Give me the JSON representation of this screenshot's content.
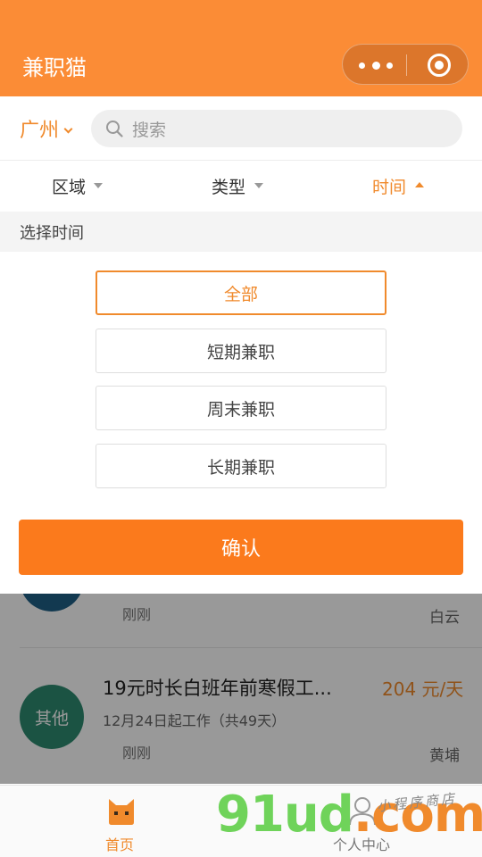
{
  "nav": {
    "title": "兼职猫"
  },
  "search": {
    "city": "广州",
    "placeholder": "搜索"
  },
  "filters": [
    {
      "label": "区域",
      "active": false
    },
    {
      "label": "类型",
      "active": false
    },
    {
      "label": "时间",
      "active": true
    }
  ],
  "dropdown": {
    "header": "选择时间",
    "options": [
      {
        "label": "全部",
        "selected": true
      },
      {
        "label": "短期兼职",
        "selected": false
      },
      {
        "label": "周末兼职",
        "selected": false
      },
      {
        "label": "长期兼职",
        "selected": false
      }
    ],
    "confirm_label": "确认"
  },
  "jobs": [
    {
      "time": "刚刚",
      "area": "白云",
      "avatar_color": "#1f5f86"
    },
    {
      "avatar_label": "其他",
      "avatar_color": "#2e8a70",
      "title": "19元时长白班年前寒假工...",
      "salary": "204 元/天",
      "start": "12月24日起工作（共49天）",
      "time": "刚刚",
      "area": "黄埔"
    }
  ],
  "tabbar": {
    "home_label": "首页",
    "user_label": "个人中心"
  },
  "watermark": {
    "brand": "91ud.com",
    "tagline": "小程序商店"
  },
  "colors": {
    "accent": "#fb8c36",
    "button": "#fb7a1c",
    "text_accent": "#f08a2c"
  }
}
